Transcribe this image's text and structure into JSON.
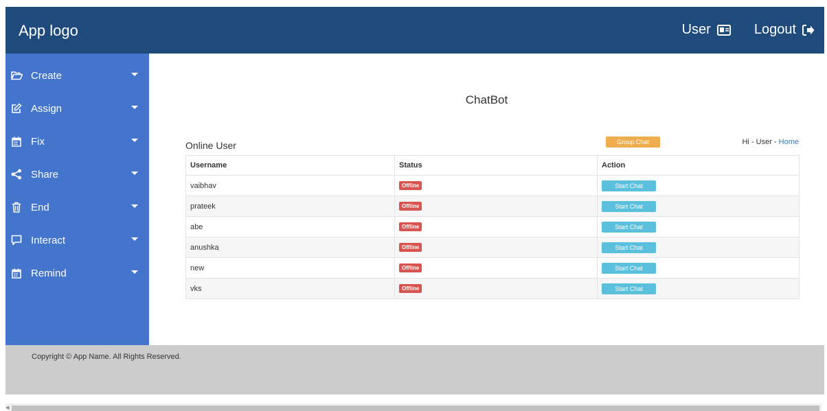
{
  "header": {
    "logo": "App logo",
    "user_label": "User",
    "logout_label": "Logout",
    "colors": {
      "bg": "#1f4a7c"
    }
  },
  "sidebar": {
    "colors": {
      "bg": "#4475cc"
    },
    "items": [
      {
        "label": "Create",
        "icon": "folder-open-icon"
      },
      {
        "label": "Assign",
        "icon": "edit-icon"
      },
      {
        "label": "Fix",
        "icon": "calendar-icon"
      },
      {
        "label": "Share",
        "icon": "share-icon"
      },
      {
        "label": "End",
        "icon": "trash-icon"
      },
      {
        "label": "Interact",
        "icon": "comment-icon"
      },
      {
        "label": "Remind",
        "icon": "calendar-icon"
      }
    ]
  },
  "main": {
    "title": "ChatBot",
    "section_title": "Online User",
    "group_chat_label": "Group Chat",
    "greeting": {
      "prefix": "Hi - User - ",
      "link": "Home"
    },
    "table": {
      "headers": [
        "Username",
        "Status",
        "Action"
      ],
      "rows": [
        {
          "username": "vaibhav",
          "status": "Offline",
          "action": "Start Chat"
        },
        {
          "username": "prateek",
          "status": "Offline",
          "action": "Start Chat"
        },
        {
          "username": "abe",
          "status": "Offline",
          "action": "Start Chat"
        },
        {
          "username": "anushka",
          "status": "Offline",
          "action": "Start Chat"
        },
        {
          "username": "new",
          "status": "Offline",
          "action": "Start Chat"
        },
        {
          "username": "vks",
          "status": "Offline",
          "action": "Start Chat"
        }
      ]
    }
  },
  "footer": {
    "copyright": "Copyright © App Name. All Rights Reserved."
  }
}
